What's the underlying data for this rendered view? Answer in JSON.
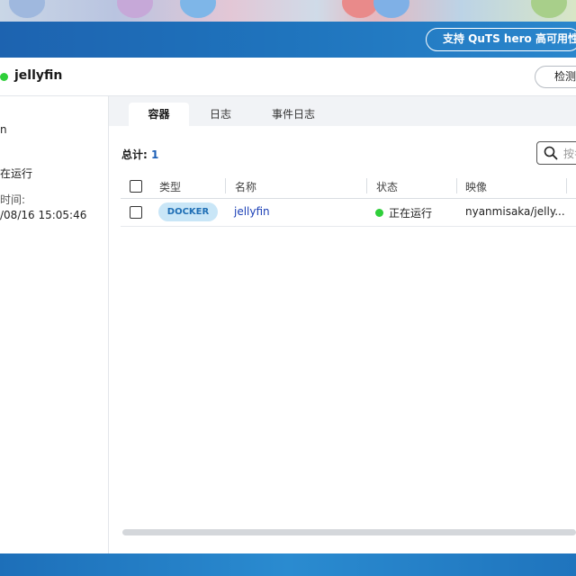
{
  "header": {
    "hero_button_label": "支持 QuTS hero 高可用性"
  },
  "app": {
    "title": "jellyfin",
    "status_color": "#2fcf3a",
    "detect_button_label": "检测"
  },
  "sidebar": {
    "name_fragment": "n",
    "status_value": "在运行",
    "time_label": "时间:",
    "time_value": "/08/16 15:05:46"
  },
  "tabs": [
    {
      "label": "容器",
      "active": true
    },
    {
      "label": "日志",
      "active": false
    },
    {
      "label": "事件日志",
      "active": false
    }
  ],
  "summary": {
    "total_label": "总计:",
    "total_value": "1"
  },
  "search": {
    "placeholder": "按名"
  },
  "table": {
    "columns": [
      "类型",
      "名称",
      "状态",
      "映像"
    ],
    "rows": [
      {
        "type": "DOCKER",
        "name": "jellyfin",
        "status": "正在运行",
        "image": "nyanmisaka/jelly..."
      }
    ]
  },
  "colors": {
    "accent": "#1f74bd",
    "link": "#1a3fb6",
    "running": "#2fcf3a",
    "badge_bg": "#c9e6f7"
  }
}
